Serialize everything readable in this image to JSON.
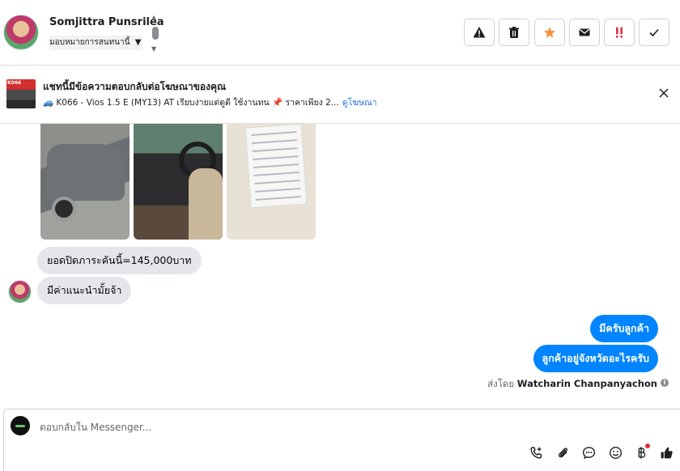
{
  "header": {
    "contact_name": "Somjittra Punsrilea",
    "assign_label": "มอบหมายการสนทนานี้",
    "actions": [
      {
        "label": "Mark as spam",
        "icon": "warning-icon"
      },
      {
        "label": "Delete",
        "icon": "trash-icon"
      },
      {
        "label": "Star",
        "icon": "star-icon"
      },
      {
        "label": "Mark unread",
        "icon": "envelope-icon"
      },
      {
        "label": "Follow up",
        "icon": "double-exclamation-icon"
      },
      {
        "label": "Mark done",
        "icon": "checkmark-icon"
      }
    ],
    "colors": {
      "star": "#f7923b",
      "followup": "#e02e3f"
    }
  },
  "ad_banner": {
    "title": "แชทนี้มีข้อความตอบกลับต่อโฆษณาของคุณ",
    "description": "🚙 K066 - Vios 1.5 E (MY13) AT เรียบง่ายแต่ดูดี ใช้งานทน 📌 ราคาเพียง 2...",
    "link_label": "ดูโฆษณา",
    "thumb_tag": "K066"
  },
  "messages": {
    "incoming": [
      {
        "text": "ยอดปิดภาระคันนี้=145,000บาท"
      },
      {
        "text": "มีค่าแนะนำมั้ยจ้า"
      }
    ],
    "outgoing": [
      {
        "text": "มีครับลูกค้า"
      },
      {
        "text": "ลูกค้าอยู่จังหวัดอะไรครับ"
      }
    ],
    "sent_by_prefix": "ส่งโดย",
    "sent_by_name": "Watcharin Chanpanyachon",
    "info_icon": "i"
  },
  "composer": {
    "placeholder": "ตอบกลับใน Messenger...",
    "tools": [
      "phone-add-icon",
      "paperclip-icon",
      "chat-bubble-icon",
      "smiley-icon",
      "baht-icon",
      "thumbs-up-icon"
    ]
  }
}
